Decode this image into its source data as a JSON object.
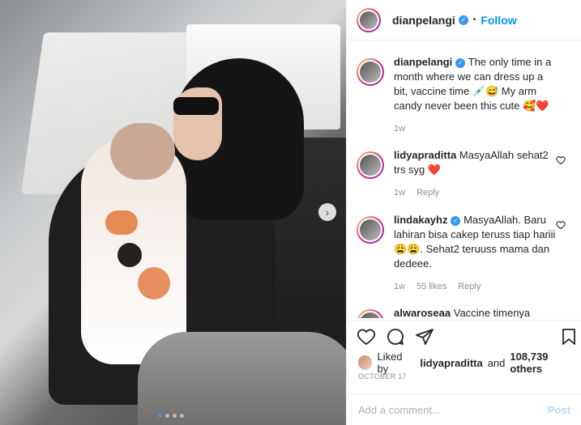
{
  "post": {
    "author": "dianpelangi",
    "follow_label": "Follow",
    "separator": "•"
  },
  "comments": [
    {
      "user": "dianpelangi",
      "verified": true,
      "text": "The only time in a month where we can dress up a bit, vaccine time 💉😅 My arm candy never been this cute 🥰❤️",
      "time": "1w",
      "likes": "",
      "reply": ""
    },
    {
      "user": "lidyapraditta",
      "verified": false,
      "text": "MasyaAllah sehat2 trs syg ❤️",
      "time": "1w",
      "likes": "",
      "reply": "Reply"
    },
    {
      "user": "lindakayhz",
      "verified": true,
      "text": "MasyaAllah. Baru lahiran bisa cakep teruss tiap hariii 😩😩. Sehat2 teruuss mama dan dedeee.",
      "time": "1w",
      "likes": "55 likes",
      "reply": "Reply"
    },
    {
      "user": "alwaroseaa",
      "verified": false,
      "text": "Vaccine timenya",
      "time": "",
      "likes": "",
      "reply": ""
    }
  ],
  "likes": {
    "prefix": "Liked by",
    "user": "lidyapraditta",
    "and": "and",
    "others": "108,739 others"
  },
  "date": "OCTOBER 17",
  "add_comment": {
    "placeholder": "Add a comment...",
    "post_label": "Post"
  },
  "carousel": {
    "count": 4,
    "active_index": 0
  },
  "icons": {
    "verified": "verified-badge-icon",
    "like": "heart-icon",
    "comment": "comment-icon",
    "share": "paper-plane-icon",
    "save": "bookmark-icon",
    "next": "chevron-right-icon"
  },
  "colors": {
    "accent": "#0095f6",
    "verified": "#3897f0",
    "muted": "#8e8e8e"
  }
}
